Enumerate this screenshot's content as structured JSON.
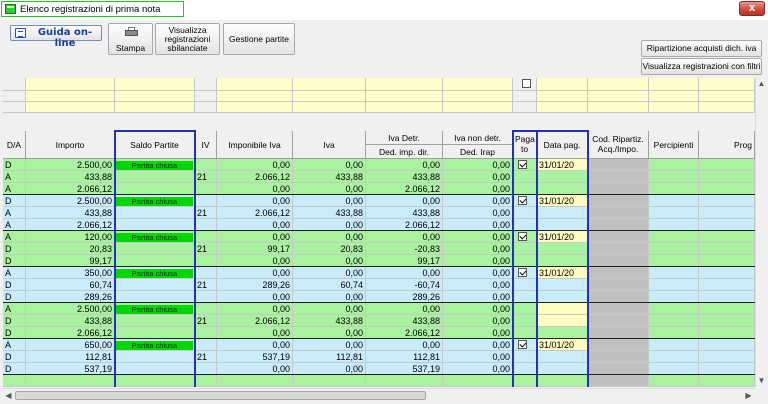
{
  "window": {
    "title": "Elenco registrazioni di prima nota",
    "close_label": "x"
  },
  "toolbar": {
    "guida_label": "Guida on-line",
    "stampa_label": "Stampa",
    "visualizza_sbilanciate_label": "Visualizza registrazioni sbilanciate",
    "gestione_partite_label": "Gestione partite",
    "ripartizione_label": "Ripartizione acquisti dich. iva",
    "visualizza_filtri_label": "Visualizza registrazioni con filtri"
  },
  "columns": {
    "da": "D/A",
    "importo": "Importo",
    "saldo_partite": "Saldo Partite",
    "iv": "IV",
    "imponibile_iva": "Imponibile Iva",
    "iva": "Iva",
    "iva_detr": "Iva Detr.",
    "ded_imp_dir": "Ded. imp. dir.",
    "iva_non_detr": "Iva non detr.",
    "ded_irap": "Ded. Irap",
    "pagato": "Paga to",
    "data_pag": "Data pag.",
    "cod_ripartiz": "Cod. Ripartiz. Acq./Impo.",
    "percipienti": "Percipienti",
    "prog": "Prog"
  },
  "filter": {
    "pagato_checked": false
  },
  "groups": [
    {
      "color": "green",
      "saldo": "Partita chiusa",
      "pagato": true,
      "data_pag": "31/01/20",
      "rows": [
        {
          "da": "D",
          "importo": "2.500,00",
          "iv": "",
          "imponibile": "0,00",
          "iva": "0,00",
          "iva_detr": "0,00",
          "iva_non_detr": "0,00"
        },
        {
          "da": "A",
          "importo": "433,88",
          "iv": "21",
          "imponibile": "2.066,12",
          "iva": "433,88",
          "iva_detr": "433,88",
          "iva_non_detr": "0,00"
        },
        {
          "da": "A",
          "importo": "2.066,12",
          "iv": "",
          "imponibile": "0,00",
          "iva": "0,00",
          "iva_detr": "2.066,12",
          "iva_non_detr": "0,00"
        }
      ]
    },
    {
      "color": "blue",
      "saldo": "Partita chiusa",
      "pagato": true,
      "data_pag": "31/01/20",
      "rows": [
        {
          "da": "D",
          "importo": "2.500,00",
          "iv": "",
          "imponibile": "0,00",
          "iva": "0,00",
          "iva_detr": "0,00",
          "iva_non_detr": "0,00"
        },
        {
          "da": "A",
          "importo": "433,88",
          "iv": "21",
          "imponibile": "2.066,12",
          "iva": "433,88",
          "iva_detr": "433,88",
          "iva_non_detr": "0,00"
        },
        {
          "da": "A",
          "importo": "2.066,12",
          "iv": "",
          "imponibile": "0,00",
          "iva": "0,00",
          "iva_detr": "2.066,12",
          "iva_non_detr": "0,00"
        }
      ]
    },
    {
      "color": "green",
      "saldo": "Partita chiusa",
      "pagato": true,
      "data_pag": "31/01/20",
      "rows": [
        {
          "da": "A",
          "importo": "120,00",
          "iv": "",
          "imponibile": "0,00",
          "iva": "0,00",
          "iva_detr": "0,00",
          "iva_non_detr": "0,00"
        },
        {
          "da": "D",
          "importo": "20,83",
          "iv": "21",
          "imponibile": "99,17",
          "iva": "20,83",
          "iva_detr": "-20,83",
          "iva_non_detr": "0,00"
        },
        {
          "da": "D",
          "importo": "99,17",
          "iv": "",
          "imponibile": "0,00",
          "iva": "0,00",
          "iva_detr": "99,17",
          "iva_non_detr": "0,00"
        }
      ]
    },
    {
      "color": "blue",
      "saldo": "Partita chiusa",
      "pagato": true,
      "data_pag": "31/01/20",
      "rows": [
        {
          "da": "A",
          "importo": "350,00",
          "iv": "",
          "imponibile": "0,00",
          "iva": "0,00",
          "iva_detr": "0,00",
          "iva_non_detr": "0,00"
        },
        {
          "da": "D",
          "importo": "60,74",
          "iv": "21",
          "imponibile": "289,26",
          "iva": "60,74",
          "iva_detr": "-60,74",
          "iva_non_detr": "0,00"
        },
        {
          "da": "D",
          "importo": "289,26",
          "iv": "",
          "imponibile": "0,00",
          "iva": "0,00",
          "iva_detr": "289,26",
          "iva_non_detr": "0,00"
        }
      ]
    },
    {
      "color": "green",
      "saldo": "Partita chiusa",
      "pagato": false,
      "data_pag": "",
      "rows": [
        {
          "da": "A",
          "importo": "2.500,00",
          "iv": "",
          "imponibile": "0,00",
          "iva": "0,00",
          "iva_detr": "0,00",
          "iva_non_detr": "0,00"
        },
        {
          "da": "D",
          "importo": "433,88",
          "iv": "21",
          "imponibile": "2.066,12",
          "iva": "433,88",
          "iva_detr": "433,88",
          "iva_non_detr": "0,00"
        },
        {
          "da": "D",
          "importo": "2.066,12",
          "iv": "",
          "imponibile": "0,00",
          "iva": "0,00",
          "iva_detr": "2.066,12",
          "iva_non_detr": "0,00"
        }
      ]
    },
    {
      "color": "blue",
      "saldo": "Partita chiusa",
      "pagato": true,
      "data_pag": "31/01/20",
      "rows": [
        {
          "da": "A",
          "importo": "650,00",
          "iv": "",
          "imponibile": "0,00",
          "iva": "0,00",
          "iva_detr": "0,00",
          "iva_non_detr": "0,00"
        },
        {
          "da": "D",
          "importo": "112,81",
          "iv": "21",
          "imponibile": "537,19",
          "iva": "112,81",
          "iva_detr": "112,81",
          "iva_non_detr": "0,00"
        },
        {
          "da": "D",
          "importo": "537,19",
          "iv": "",
          "imponibile": "0,00",
          "iva": "0,00",
          "iva_detr": "537,19",
          "iva_non_detr": "0,00"
        }
      ]
    }
  ]
}
